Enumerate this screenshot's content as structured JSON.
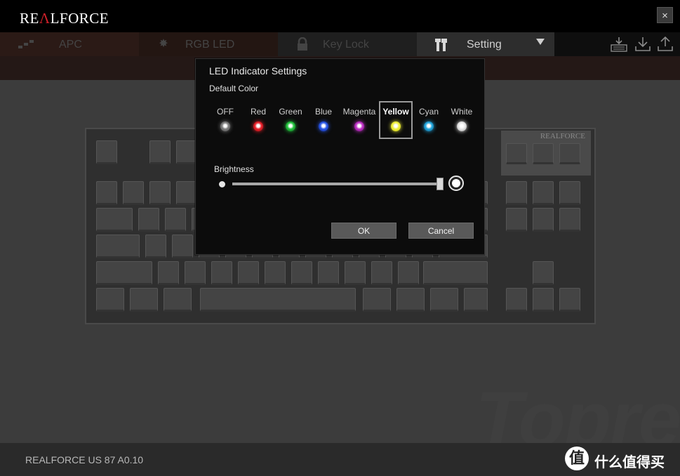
{
  "app": {
    "logo_pre": "RE",
    "logo_accent": "Λ",
    "logo_post": "LFORCE",
    "close_symbol": "×"
  },
  "tabs": [
    {
      "label": "APC",
      "icon": "apc-icon"
    },
    {
      "label": "RGB LED",
      "icon": "led-sun-icon"
    },
    {
      "label": "Key Lock",
      "icon": "lock-icon"
    },
    {
      "label": "Setting",
      "icon": "tools-icon"
    }
  ],
  "toolbar": {
    "icons": [
      "keyboard-download-icon",
      "download-icon",
      "upload-icon"
    ]
  },
  "keyboard": {
    "brand": "REALFORCE"
  },
  "modal": {
    "title": "LED Indicator Settings",
    "subtitle": "Default Color",
    "colors": [
      {
        "label": "OFF",
        "color": "#7a7a7a",
        "glow": "#555555"
      },
      {
        "label": "Red",
        "color": "#e8202a",
        "glow": "#a01010"
      },
      {
        "label": "Green",
        "color": "#22c43c",
        "glow": "#116622"
      },
      {
        "label": "Blue",
        "color": "#2a58e8",
        "glow": "#102890"
      },
      {
        "label": "Magenta",
        "color": "#c030c8",
        "glow": "#701470"
      },
      {
        "label": "Yellow",
        "color": "#f0f040",
        "glow": "#c8c800"
      },
      {
        "label": "Cyan",
        "color": "#22a8e0",
        "glow": "#105a80"
      },
      {
        "label": "White",
        "color": "#e8e8e8",
        "glow": "#999999"
      }
    ],
    "selected_color": "Yellow",
    "brightness": {
      "label": "Brightness",
      "value_fraction": 1.0
    },
    "ok_label": "OK",
    "cancel_label": "Cancel"
  },
  "watermark_text": "Topre",
  "status": {
    "device": "REALFORCE US 87  A0.10"
  },
  "badge": {
    "symbol": "值",
    "text": "什么值得买"
  }
}
